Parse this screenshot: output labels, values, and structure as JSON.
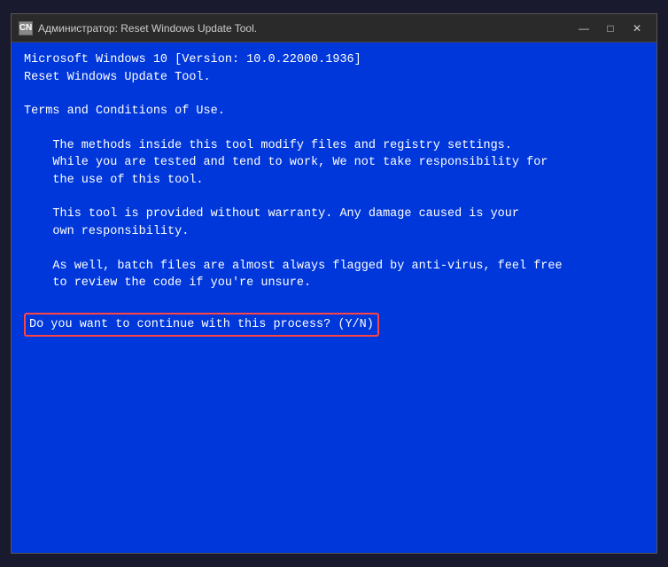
{
  "window": {
    "title": "Администратор:  Reset Windows Update Tool.",
    "icon_label": "CN",
    "controls": {
      "minimize": "—",
      "maximize": "□",
      "close": "✕"
    }
  },
  "console": {
    "lines": [
      "Microsoft Windows 10 [Version: 10.0.22000.1936]",
      "Reset Windows Update Tool.",
      "",
      "Terms and Conditions of Use.",
      "",
      "    The methods inside this tool modify files and registry settings.",
      "    While you are tested and tend to work, We not take responsibility for",
      "    the use of this tool.",
      "",
      "    This tool is provided without warranty. Any damage caused is your",
      "    own responsibility.",
      "",
      "    As well, batch files are almost always flagged by anti-virus, feel free",
      "    to review the code if you're unsure.",
      ""
    ],
    "prompt": "Do you want to continue with this process? (Y/N)"
  }
}
